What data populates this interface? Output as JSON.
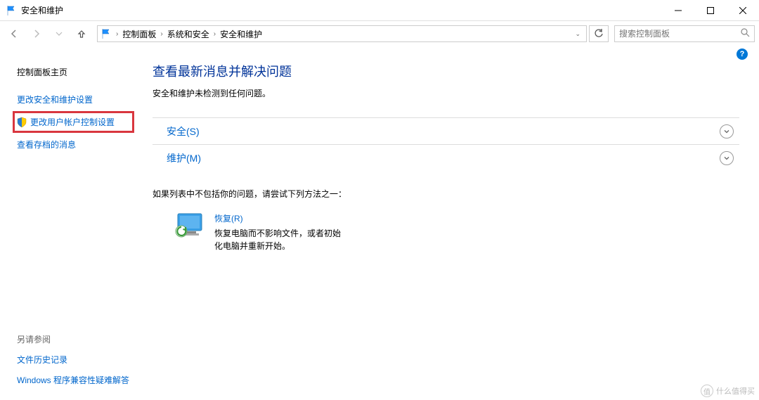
{
  "window": {
    "title": "安全和维护"
  },
  "breadcrumb": {
    "root": "控制面板",
    "mid": "系统和安全",
    "leaf": "安全和维护"
  },
  "search": {
    "placeholder": "搜索控制面板"
  },
  "sidebar": {
    "home": "控制面板主页",
    "change_security": "更改安全和维护设置",
    "change_uac": "更改用户帐户控制设置",
    "view_archived": "查看存档的消息",
    "see_also": "另请参阅",
    "file_history": "文件历史记录",
    "compat_troubleshoot": "Windows 程序兼容性疑难解答"
  },
  "main": {
    "heading": "查看最新消息并解决问题",
    "no_issues": "安全和维护未检测到任何问题。",
    "sections": {
      "security": "安全(S)",
      "maintenance": "维护(M)"
    },
    "try_other": "如果列表中不包括你的问题，请尝试下列方法之一：",
    "recovery": {
      "link": "恢复(R)",
      "desc": "恢复电脑而不影响文件，或者初始化电脑并重新开始。"
    }
  },
  "watermark": "值",
  "watermark_text": "什么值得买"
}
